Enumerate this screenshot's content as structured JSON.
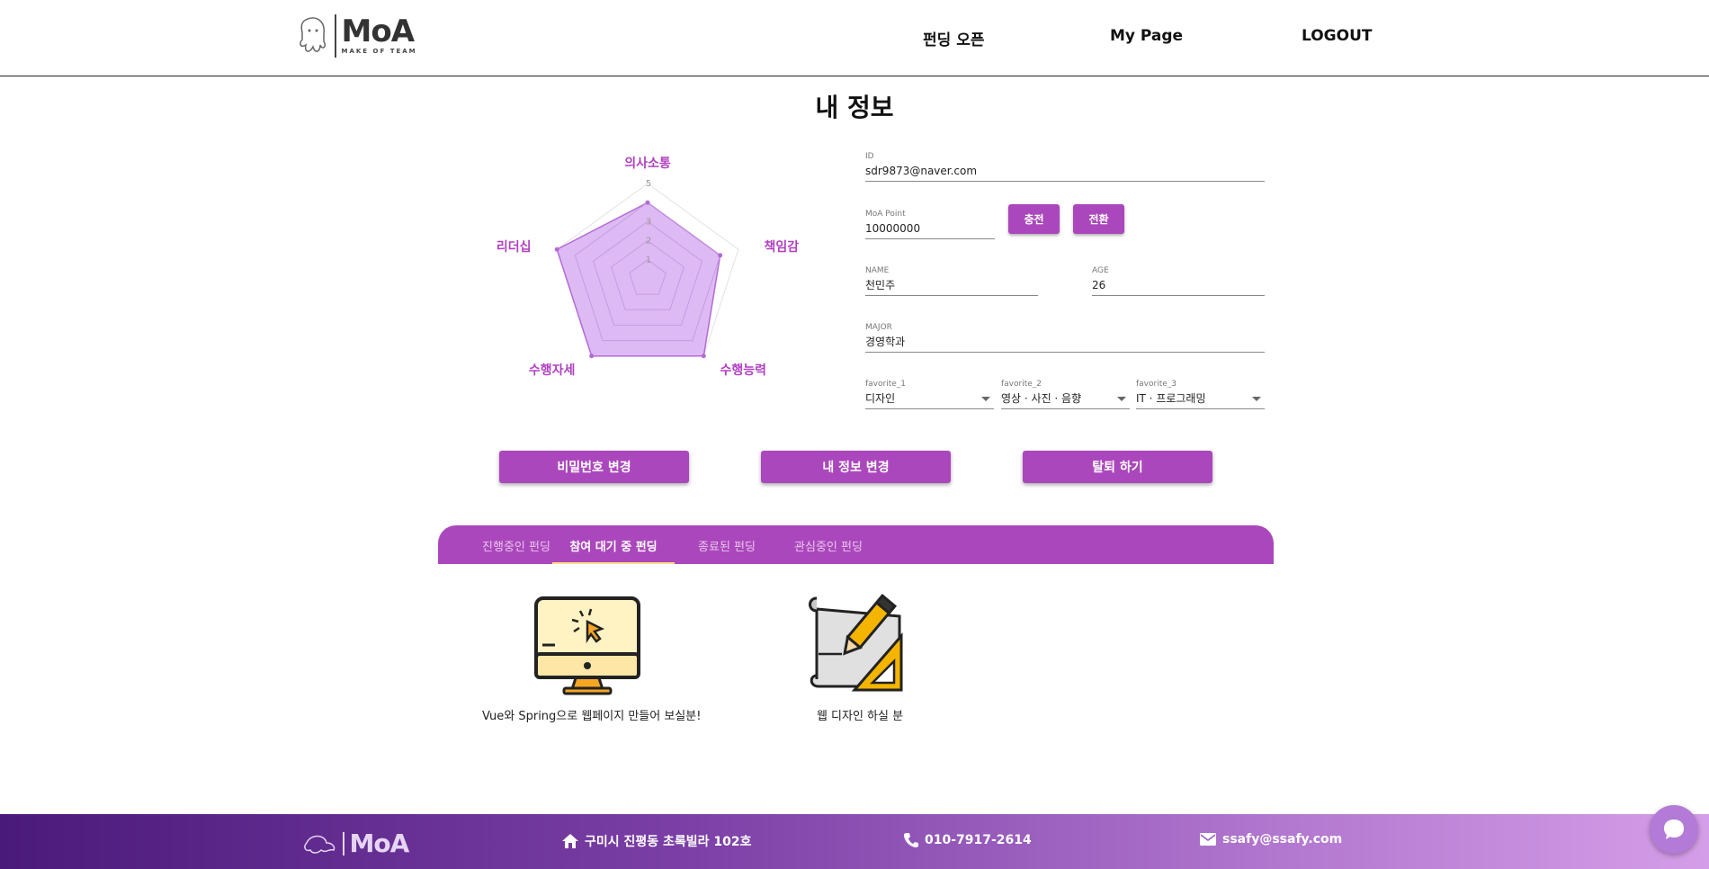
{
  "header": {
    "logo_text": "MoA",
    "logo_sub": "MAKE OF TEAM",
    "nav": [
      "펀딩 오픈",
      "My Page",
      "LOGOUT"
    ]
  },
  "page_title": "내 정보",
  "radar": {
    "axes": [
      "의사소통",
      "책임감",
      "수행능력",
      "수행자세",
      "리더십"
    ],
    "scale_max": 5,
    "ticks": [
      "1",
      "2",
      "3",
      "5"
    ],
    "values": [
      4,
      4,
      5,
      5,
      5
    ],
    "fill_color": "#d9b3f2",
    "stroke_color": "#b46ad6"
  },
  "profile": {
    "id_label": "ID",
    "id_value": "sdr9873@naver.com",
    "point_label": "MoA Point",
    "point_value": "10000000",
    "charge_label": "충전",
    "convert_label": "전환",
    "name_label": "NAME",
    "name_value": "천민주",
    "age_label": "AGE",
    "age_value": "26",
    "major_label": "MAJOR",
    "major_value": "경영학과",
    "fav1_label": "favorite_1",
    "fav1_value": "디자인",
    "fav2_label": "favorite_2",
    "fav2_value": "영상 · 사진 · 음향",
    "fav3_label": "favorite_3",
    "fav3_value": "IT · 프로그래밍"
  },
  "actions": {
    "change_password": "비밀번호 변경",
    "change_info": "내 정보 변경",
    "withdraw": "탈퇴 하기"
  },
  "tabs": [
    "진행중인 펀딩",
    "참여 대기 중 펀딩",
    "종료된 펀딩",
    "관심중인 펀딩"
  ],
  "active_tab": 1,
  "fundings": [
    {
      "title": "Vue와 Spring으로 웹페이지 만들어 보실분!",
      "icon": "computer-click-icon"
    },
    {
      "title": "웹 디자인 하실 분",
      "icon": "design-pencil-ruler-icon"
    }
  ],
  "footer": {
    "address": "구미시 진평동 초록빌라 102호",
    "phone": "010-7917-2614",
    "email": "ssafy@ssafy.com"
  },
  "colors": {
    "accent": "#ab47bc",
    "tab_indicator": "#ffe082"
  }
}
